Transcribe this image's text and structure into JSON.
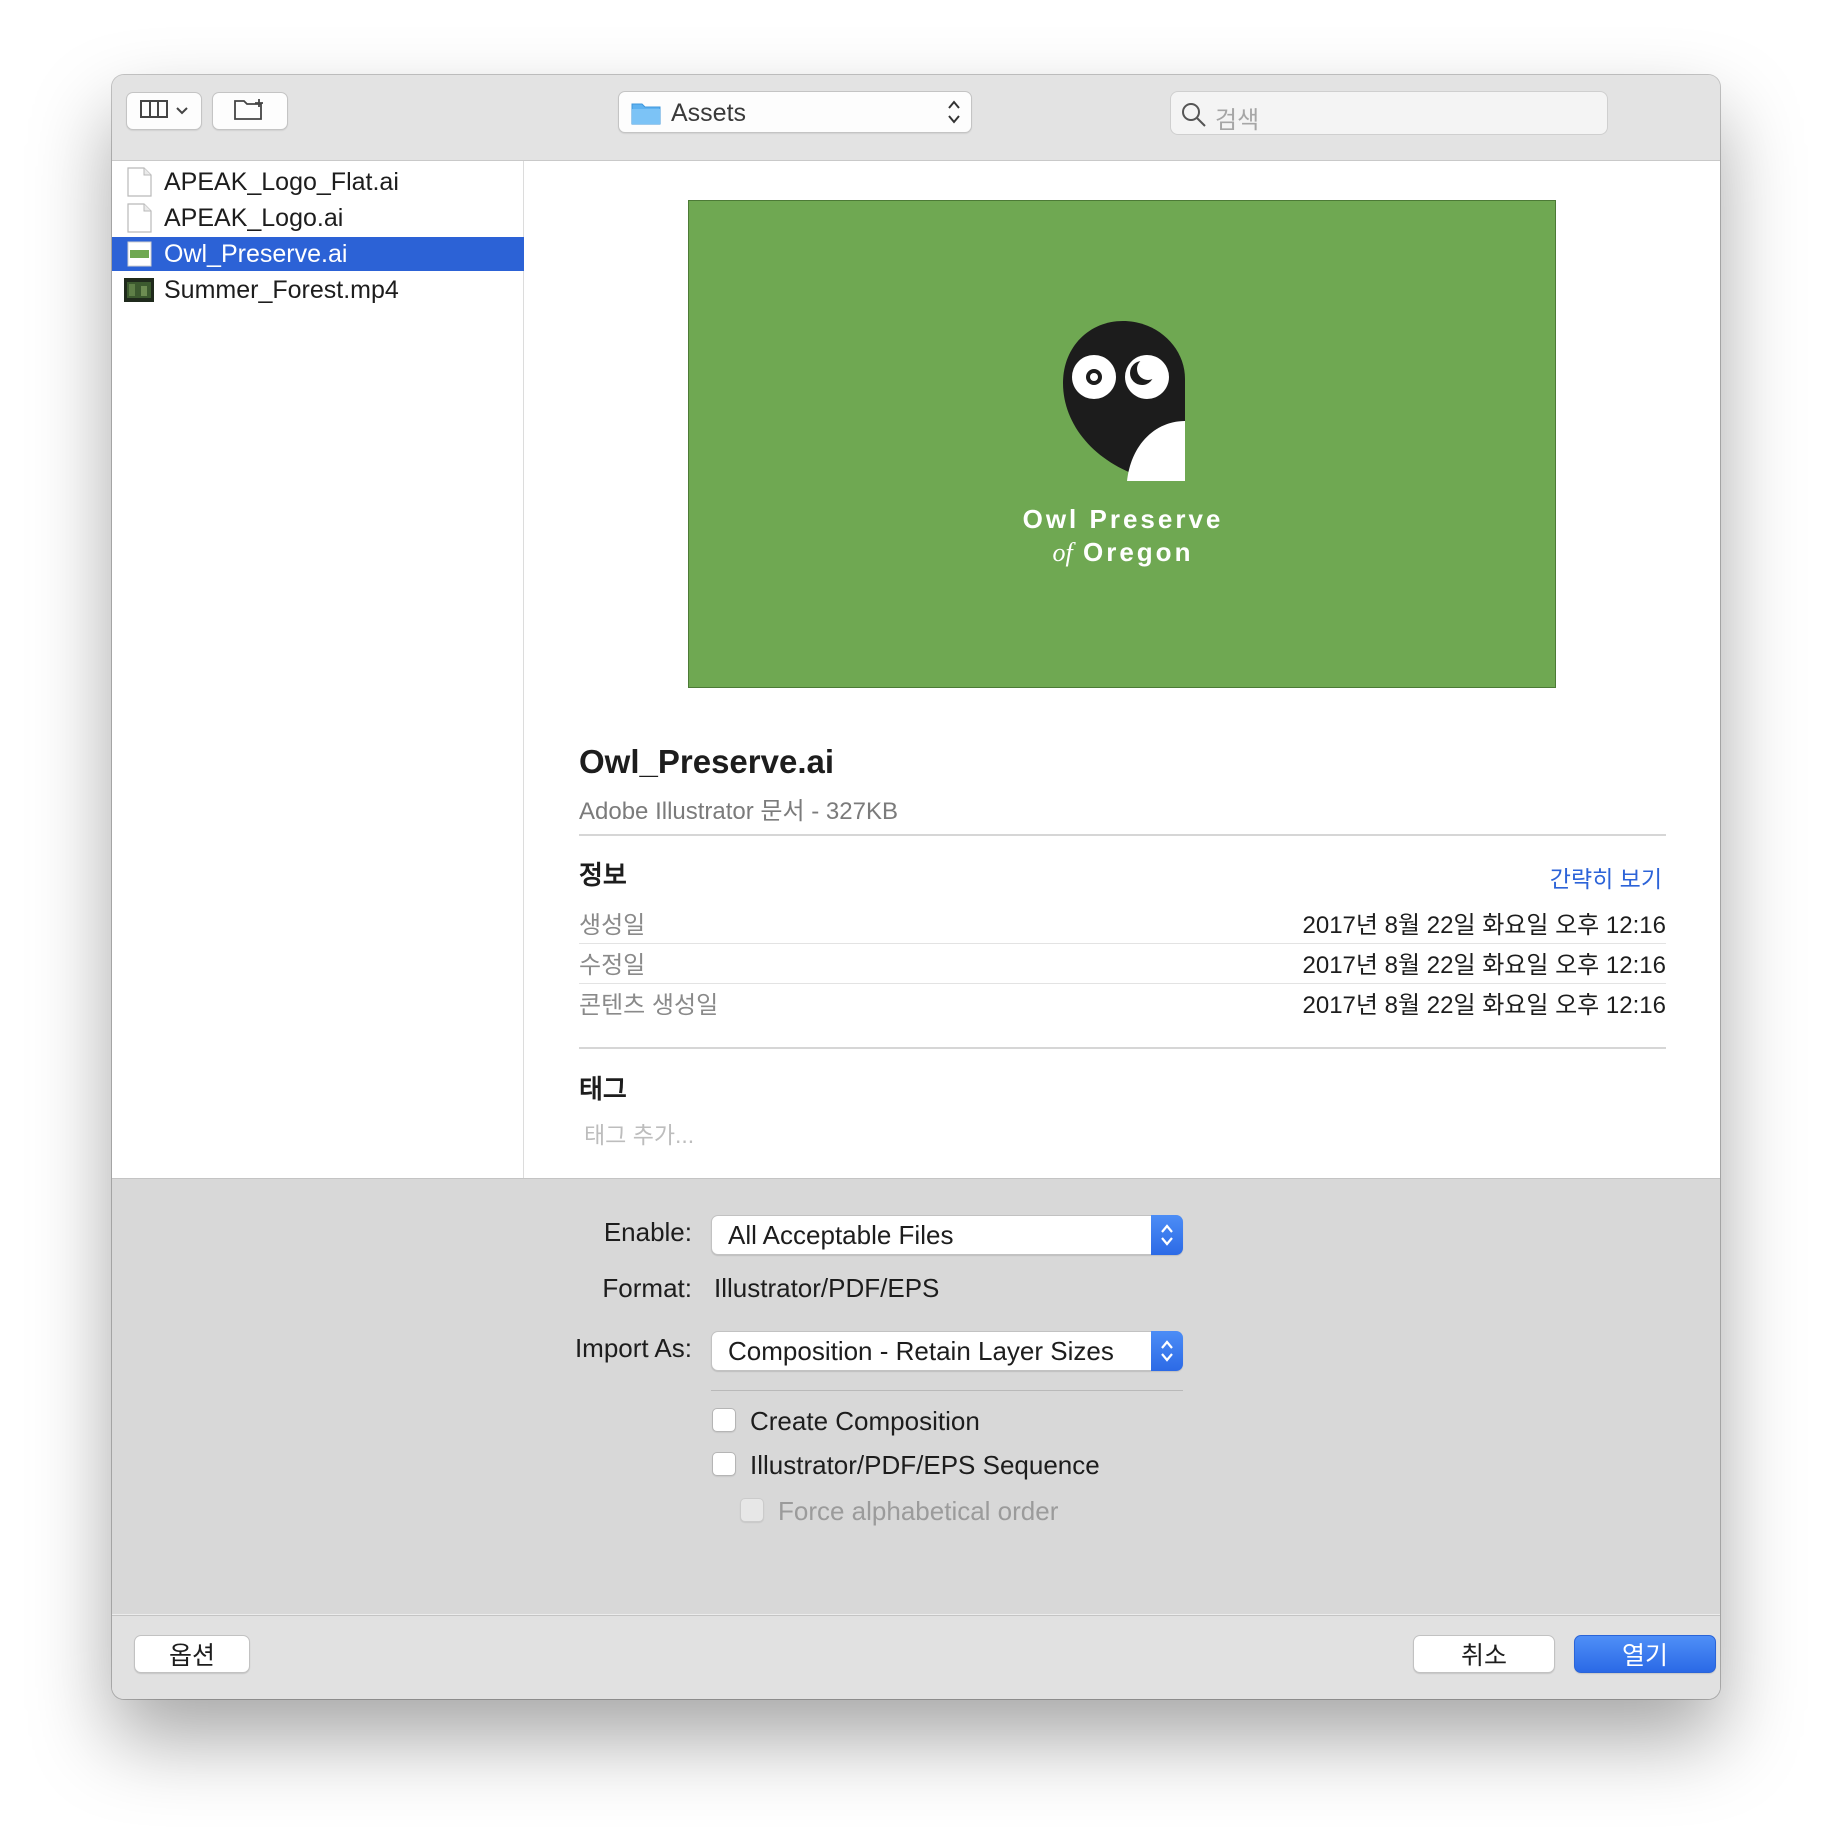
{
  "toolbar": {
    "location": "Assets",
    "search_placeholder": "검색"
  },
  "files": [
    {
      "name": "APEAK_Logo_Flat.ai",
      "icon": "document-icon",
      "selected": false
    },
    {
      "name": "APEAK_Logo.ai",
      "icon": "document-icon",
      "selected": false
    },
    {
      "name": "Owl_Preserve.ai",
      "icon": "ai-thumbnail-icon",
      "selected": true
    },
    {
      "name": "Summer_Forest.mp4",
      "icon": "video-thumbnail-icon",
      "selected": false
    }
  ],
  "preview": {
    "logo_line1": "Owl Preserve",
    "logo_of": "of",
    "logo_line2": "Oregon",
    "bg_color": "#6fa852",
    "file_name": "Owl_Preserve.ai",
    "file_kind": "Adobe Illustrator 문서 - 327KB",
    "info_heading": "정보",
    "info_toggle": "간략히 보기",
    "info_rows": [
      {
        "label": "생성일",
        "value": "2017년 8월 22일 화요일 오후 12:16"
      },
      {
        "label": "수정일",
        "value": "2017년 8월 22일 화요일 오후 12:16"
      },
      {
        "label": "콘텐츠 생성일",
        "value": "2017년 8월 22일 화요일 오후 12:16"
      }
    ],
    "tags_heading": "태그",
    "tags_placeholder": "태그 추가..."
  },
  "accessory": {
    "enable_label": "Enable:",
    "enable_value": "All Acceptable Files",
    "format_label": "Format:",
    "format_value": "Illustrator/PDF/EPS",
    "import_as_label": "Import As:",
    "import_as_value": "Composition - Retain Layer Sizes",
    "create_composition": "Create Composition",
    "sequence": "Illustrator/PDF/EPS Sequence",
    "force_alpha": "Force alphabetical order"
  },
  "buttons": {
    "options": "옵션",
    "cancel": "취소",
    "open": "열기"
  },
  "colors": {
    "accent": "#2c62d6",
    "selection": "#2c62d6"
  }
}
